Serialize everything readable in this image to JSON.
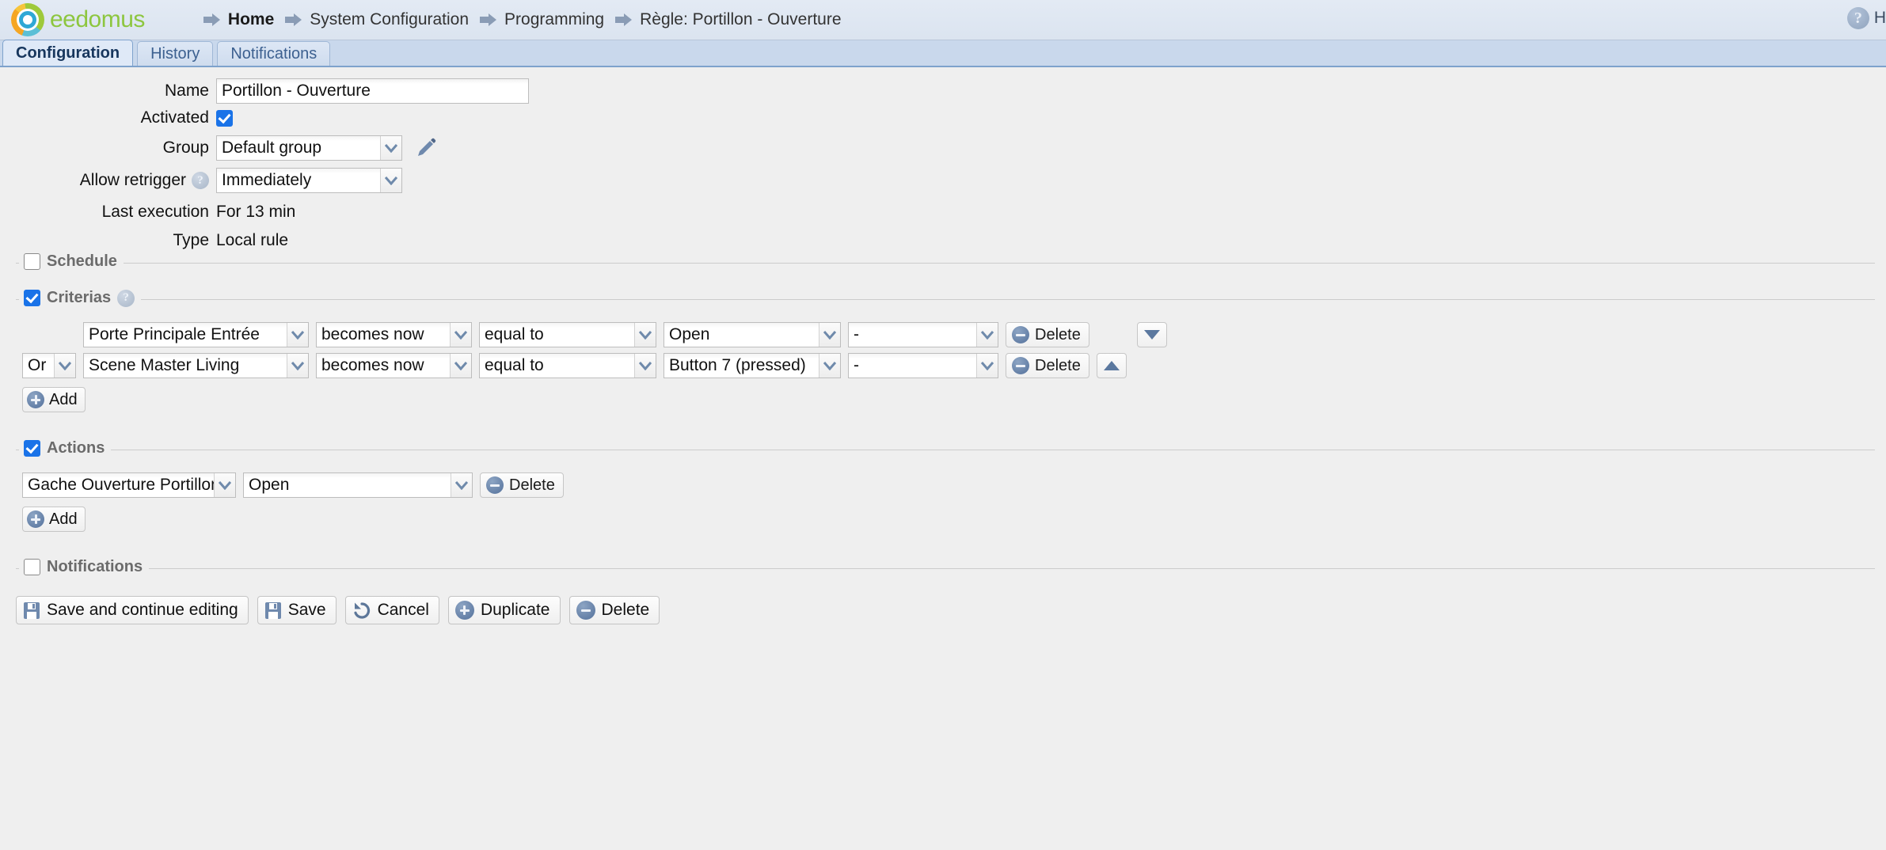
{
  "header": {
    "brand": "eedomus",
    "brand_color": "#8dc63f",
    "logo_icon": "eedomus-ring-logo",
    "breadcrumbs": [
      {
        "label": "Home",
        "current": true
      },
      {
        "label": "System Configuration",
        "current": false
      },
      {
        "label": "Programming",
        "current": false
      },
      {
        "label": "Règle: Portillon - Ouverture",
        "current": false
      }
    ],
    "help": {
      "icon": "question-mark-icon",
      "label": "H"
    }
  },
  "tabs": [
    {
      "label": "Configuration",
      "active": true
    },
    {
      "label": "History",
      "active": false
    },
    {
      "label": "Notifications",
      "active": false
    }
  ],
  "form": {
    "name": {
      "label": "Name",
      "value": "Portillon - Ouverture"
    },
    "activated": {
      "label": "Activated",
      "checked": true
    },
    "group": {
      "label": "Group",
      "value": "Default group",
      "edit_icon": "pencil-icon"
    },
    "allow_retrigger": {
      "label": "Allow retrigger",
      "value": "Immediately",
      "help_icon": "question-mark-icon"
    },
    "last_execution": {
      "label": "Last execution",
      "value": "For 13 min"
    },
    "type": {
      "label": "Type",
      "value": "Local rule"
    }
  },
  "sections": {
    "schedule": {
      "title": "Schedule",
      "checked": false
    },
    "criterias": {
      "title": "Criterias",
      "checked": true,
      "help_icon": "question-mark-icon",
      "add_label": "Add",
      "delete_label": "Delete",
      "rows": [
        {
          "conjunction": "",
          "device": "Porte Principale Entrée",
          "event": "becomes now",
          "comparator": "equal to",
          "value": "Open",
          "extra": "-",
          "delete_label": "Delete",
          "move": "down"
        },
        {
          "conjunction": "Or",
          "device": "Scene Master Living",
          "event": "becomes now",
          "comparator": "equal to",
          "value": "Button 7 (pressed)",
          "extra": "-",
          "delete_label": "Delete",
          "move": "up"
        }
      ]
    },
    "actions": {
      "title": "Actions",
      "checked": true,
      "add_label": "Add",
      "rows": [
        {
          "device": "Gache Ouverture Portillon Entrée",
          "value": "Open",
          "delete_label": "Delete"
        }
      ]
    },
    "notifications": {
      "title": "Notifications",
      "checked": false
    }
  },
  "footer": {
    "buttons": [
      {
        "label": "Save and continue editing",
        "icon": "floppy-disk-icon"
      },
      {
        "label": "Save",
        "icon": "floppy-disk-icon"
      },
      {
        "label": "Cancel",
        "icon": "undo-arrow-icon"
      },
      {
        "label": "Duplicate",
        "icon": "plus-circle-icon"
      },
      {
        "label": "Delete",
        "icon": "minus-circle-icon"
      }
    ]
  }
}
